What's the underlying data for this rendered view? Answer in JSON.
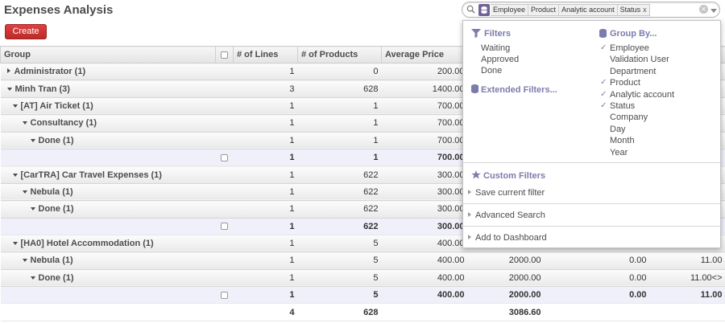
{
  "page": {
    "title": "Expenses Analysis",
    "create_label": "Create"
  },
  "search": {
    "facet_values": [
      "Employee",
      "Product",
      "Analytic account",
      "Status"
    ],
    "facet_remove": "x"
  },
  "table": {
    "headers": [
      "Group",
      "# of Lines",
      "# of Products",
      "Average Price"
    ],
    "rows": [
      {
        "kind": "grp",
        "level": 0,
        "expanded": false,
        "name": "Administrator (1)",
        "lines": "1",
        "products": "0",
        "avg": "200.00",
        "c5": "",
        "c6": "",
        "c7": ""
      },
      {
        "kind": "grp",
        "level": 0,
        "expanded": true,
        "name": "Minh Tran (3)",
        "lines": "3",
        "products": "628",
        "avg": "1400.00",
        "c5": "",
        "c6": "",
        "c7": ""
      },
      {
        "kind": "grp",
        "level": 1,
        "expanded": true,
        "name": "[AT] Air Ticket (1)",
        "lines": "1",
        "products": "1",
        "avg": "700.00",
        "c5": "",
        "c6": "",
        "c7": ""
      },
      {
        "kind": "grp",
        "level": 2,
        "expanded": true,
        "name": "Consultancy (1)",
        "lines": "1",
        "products": "1",
        "avg": "700.00",
        "c5": "",
        "c6": "",
        "c7": ""
      },
      {
        "kind": "grp",
        "level": 3,
        "expanded": true,
        "name": "Done (1)",
        "lines": "1",
        "products": "1",
        "avg": "700.00",
        "c5": "",
        "c6": "",
        "c7": ""
      },
      {
        "kind": "rec",
        "name": "",
        "lines": "1",
        "products": "1",
        "avg": "700.00",
        "c5": "",
        "c6": "",
        "c7": ""
      },
      {
        "kind": "grp",
        "level": 1,
        "expanded": true,
        "name": "[CarTRA] Car Travel Expenses (1)",
        "lines": "1",
        "products": "622",
        "avg": "300.00",
        "c5": "",
        "c6": "",
        "c7": ""
      },
      {
        "kind": "grp",
        "level": 2,
        "expanded": true,
        "name": "Nebula (1)",
        "lines": "1",
        "products": "622",
        "avg": "300.00",
        "c5": "",
        "c6": "",
        "c7": ""
      },
      {
        "kind": "grp",
        "level": 3,
        "expanded": true,
        "name": "Done (1)",
        "lines": "1",
        "products": "622",
        "avg": "300.00",
        "c5": "",
        "c6": "",
        "c7": ""
      },
      {
        "kind": "rec",
        "name": "",
        "lines": "1",
        "products": "622",
        "avg": "300.00",
        "c5": "",
        "c6": "",
        "c7": ""
      },
      {
        "kind": "grp",
        "level": 1,
        "expanded": true,
        "name": "[HA0] Hotel Accommodation (1)",
        "lines": "1",
        "products": "5",
        "avg": "400.00",
        "c5": "",
        "c6": "",
        "c7": ""
      },
      {
        "kind": "grp",
        "level": 2,
        "expanded": true,
        "name": "Nebula (1)",
        "lines": "1",
        "products": "5",
        "avg": "400.00",
        "c5": "2000.00",
        "c6": "0.00",
        "c7": "11.00"
      },
      {
        "kind": "grp",
        "level": 3,
        "expanded": true,
        "name": "Done (1)",
        "lines": "1",
        "products": "5",
        "avg": "400.00",
        "c5": "2000.00",
        "c6": "0.00",
        "c7": "11.00<>"
      },
      {
        "kind": "rec",
        "name": "",
        "lines": "1",
        "products": "5",
        "avg": "400.00",
        "c5": "2000.00",
        "c6": "0.00",
        "c7": "11.00"
      }
    ],
    "total": {
      "lines": "4",
      "products": "628",
      "avg": "",
      "c5": "3086.60",
      "c6": "",
      "c7": ""
    }
  },
  "dropdown": {
    "filters_title": "Filters",
    "filters": [
      "Waiting",
      "Approved",
      "Done"
    ],
    "extended_title": "Extended Filters...",
    "groupby_title": "Group By...",
    "groupby": [
      {
        "label": "Employee",
        "checked": true
      },
      {
        "label": "Validation User",
        "checked": false
      },
      {
        "label": "Department",
        "checked": false
      },
      {
        "label": "Product",
        "checked": true
      },
      {
        "label": "Analytic account",
        "checked": true
      },
      {
        "label": "Status",
        "checked": true
      },
      {
        "label": "Company",
        "checked": false
      },
      {
        "label": "Day",
        "checked": false
      },
      {
        "label": "Month",
        "checked": false
      },
      {
        "label": "Year",
        "checked": false
      }
    ],
    "custom_title": "Custom Filters",
    "save_filter": "Save current filter",
    "advanced_search": "Advanced Search",
    "add_dashboard": "Add to Dashboard"
  },
  "colors": {
    "accent": "#7c7bad",
    "create": "#d33a3a",
    "facet": "#6f6396"
  }
}
